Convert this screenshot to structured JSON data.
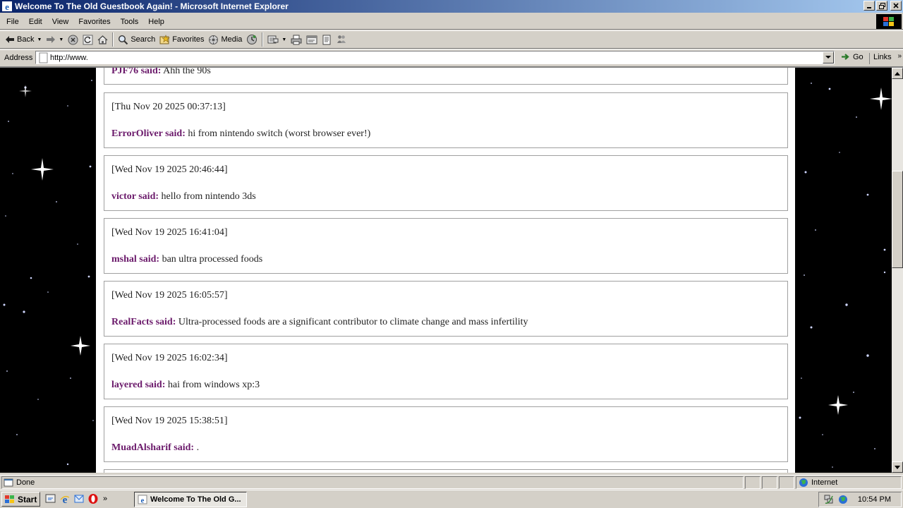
{
  "window": {
    "title": "Welcome To The Old Guestbook Again! - Microsoft Internet Explorer"
  },
  "menu": [
    "File",
    "Edit",
    "View",
    "Favorites",
    "Tools",
    "Help"
  ],
  "toolbar": {
    "back": "Back",
    "search": "Search",
    "favorites": "Favorites",
    "media": "Media"
  },
  "address": {
    "label": "Address",
    "value": "http://www.",
    "go": "Go",
    "links": "Links"
  },
  "entries": [
    {
      "timestamp": "",
      "author": "PJF76 said:",
      "message": "Ahh the 90s"
    },
    {
      "timestamp": "[Thu Nov 20 2025 00:37:13]",
      "author": "ErrorOliver said:",
      "message": "hi from nintendo switch (worst browser ever!)"
    },
    {
      "timestamp": "[Wed Nov 19 2025 20:46:44]",
      "author": "victor said:",
      "message": "hello from nintendo 3ds"
    },
    {
      "timestamp": "[Wed Nov 19 2025 16:41:04]",
      "author": "mshal said:",
      "message": "ban ultra processed foods"
    },
    {
      "timestamp": "[Wed Nov 19 2025 16:05:57]",
      "author": "RealFacts said:",
      "message": "Ultra-processed foods are a significant contributor to climate change and mass infertility"
    },
    {
      "timestamp": "[Wed Nov 19 2025 16:02:34]",
      "author": "layered said:",
      "message": "hai from windows xp:3"
    },
    {
      "timestamp": "[Wed Nov 19 2025 15:38:51]",
      "author": "MuadAlsharif said:",
      "message": "."
    }
  ],
  "status": {
    "text": "Done",
    "zone": "Internet"
  },
  "taskbar": {
    "start": "Start",
    "task": "Welcome To The Old G...",
    "clock": "10:54 PM"
  }
}
